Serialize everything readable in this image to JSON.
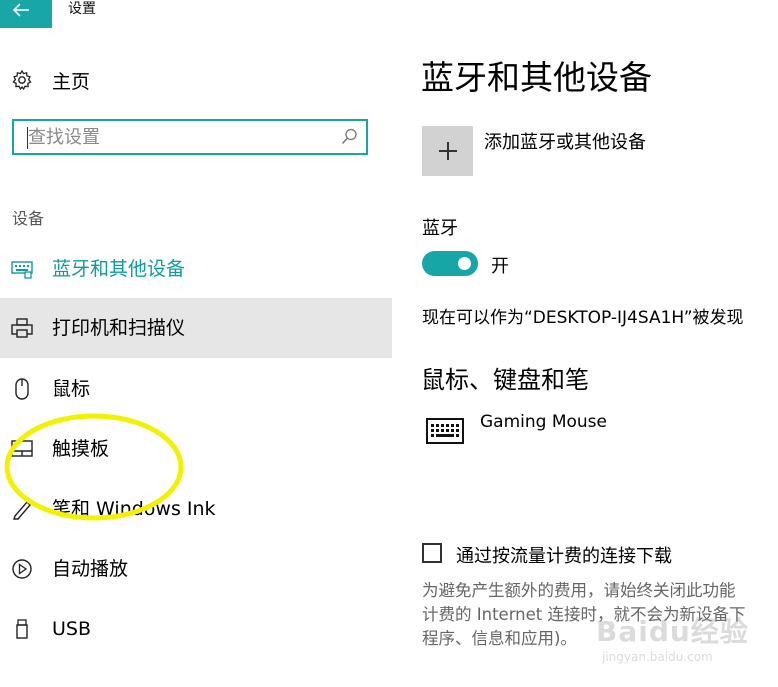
{
  "window": {
    "title": "设置"
  },
  "sidebar": {
    "home_label": "主页",
    "search": {
      "placeholder": "查找设置",
      "value": ""
    },
    "section_heading": "设备",
    "items": [
      {
        "label": "蓝牙和其他设备",
        "icon": "bluetooth-devices-icon",
        "state": "active"
      },
      {
        "label": "打印机和扫描仪",
        "icon": "printer-icon",
        "state": "hover"
      },
      {
        "label": "鼠标",
        "icon": "mouse-icon",
        "state": "normal"
      },
      {
        "label": "触摸板",
        "icon": "touchpad-icon",
        "state": "normal"
      },
      {
        "label": "笔和 Windows Ink",
        "icon": "pen-icon",
        "state": "normal"
      },
      {
        "label": "自动播放",
        "icon": "autoplay-icon",
        "state": "normal"
      },
      {
        "label": "USB",
        "icon": "usb-icon",
        "state": "normal"
      }
    ]
  },
  "main": {
    "title": "蓝牙和其他设备",
    "add_device_label": "添加蓝牙或其他设备",
    "bluetooth": {
      "label": "蓝牙",
      "toggle_state": "开",
      "on": true
    },
    "discoverable_text": "现在可以作为“DESKTOP-IJ4SA1H”被发现",
    "section_title": "鼠标、键盘和笔",
    "devices": [
      {
        "name": "Gaming Mouse",
        "icon": "keyboard-icon"
      }
    ],
    "metered": {
      "label": "通过按流量计费的连接下载",
      "checked": false,
      "description_lines": [
        "为避免产生额外的费用，请始终关闭此功能",
        "计费的 Internet 连接时，就不会为新设备下",
        "程序、信息和应用)。"
      ]
    }
  },
  "overlay": {
    "watermark_text": "Baidu经验",
    "watermark_sub": "jingyan.baidu.com"
  },
  "colors": {
    "accent": "#17a6a6",
    "annotation": "#f2f200",
    "hover": "#e6e6e6"
  }
}
